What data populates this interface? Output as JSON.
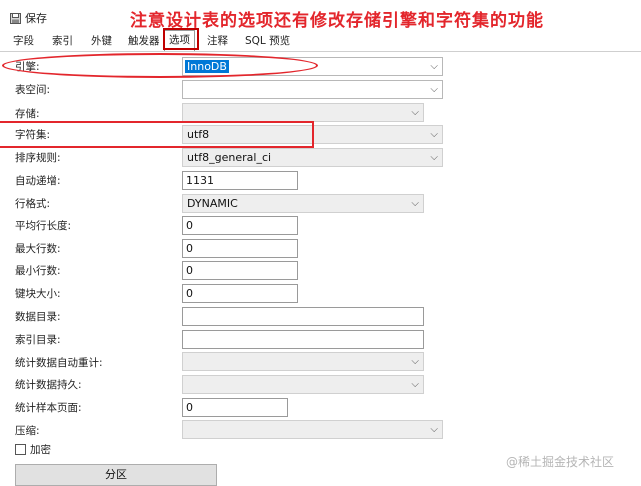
{
  "toolbar": {
    "save_label": "保存"
  },
  "annotation": "注意设计表的选项还有修改存储引擎和字符集的功能",
  "tabs": [
    "字段",
    "索引",
    "外键",
    "触发器",
    "选项",
    "注释",
    "SQL 预览"
  ],
  "active_tab": "选项",
  "form": {
    "engine": {
      "label": "引擎:",
      "value": "InnoDB"
    },
    "tablespace": {
      "label": "表空间:",
      "value": ""
    },
    "storage": {
      "label": "存储:",
      "value": ""
    },
    "charset": {
      "label": "字符集:",
      "value": "utf8"
    },
    "collation": {
      "label": "排序规则:",
      "value": "utf8_general_ci"
    },
    "auto_increment": {
      "label": "自动递增:",
      "value": "1131"
    },
    "row_format": {
      "label": "行格式:",
      "value": "DYNAMIC"
    },
    "avg_row_length": {
      "label": "平均行长度:",
      "value": "0"
    },
    "max_rows": {
      "label": "最大行数:",
      "value": "0"
    },
    "min_rows": {
      "label": "最小行数:",
      "value": "0"
    },
    "key_block_size": {
      "label": "键块大小:",
      "value": "0"
    },
    "data_directory": {
      "label": "数据目录:",
      "value": ""
    },
    "index_directory": {
      "label": "索引目录:",
      "value": ""
    },
    "stats_auto_recalc": {
      "label": "统计数据自动重计:",
      "value": ""
    },
    "stats_persistent": {
      "label": "统计数据持久:",
      "value": ""
    },
    "stats_sample_pages": {
      "label": "统计样本页面:",
      "value": "0"
    },
    "compression": {
      "label": "压缩:",
      "value": ""
    },
    "encryption": {
      "label": "加密",
      "checked": false
    }
  },
  "partition_button": "分区",
  "watermark": "@稀土掘金技术社区",
  "colors": {
    "annotation_red": "#e3262c",
    "selection_blue": "#0078d7"
  }
}
